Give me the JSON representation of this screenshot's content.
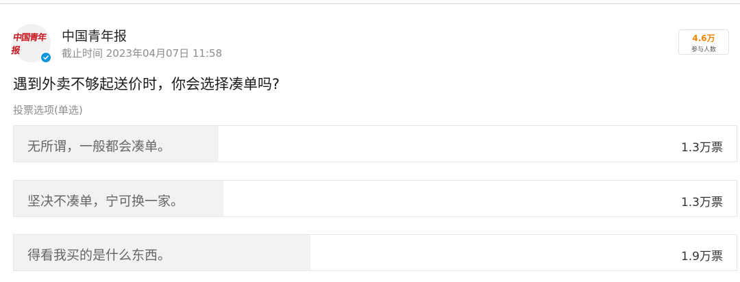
{
  "author": {
    "name": "中国青年报",
    "logo_text": "中国青年报",
    "verified_icon": "verified-check-icon",
    "verified_color": "#1296db"
  },
  "deadline": "截止时间 2023年04月07日 11:58",
  "participants": {
    "count": "4.6万",
    "label": "参与人数",
    "count_color": "#f08300"
  },
  "question": "遇到外卖不够起送价时，你会选择凑单吗?",
  "vote_type": "投票选项(单选)",
  "options": [
    {
      "text": "无所谓，一般都会凑单。",
      "votes": "1.3万票",
      "share": 0.283
    },
    {
      "text": "坚决不凑单，宁可换一家。",
      "votes": "1.3万票",
      "share": 0.29
    },
    {
      "text": "得看我买的是什么东西。",
      "votes": "1.9万票",
      "share": 0.41
    }
  ]
}
